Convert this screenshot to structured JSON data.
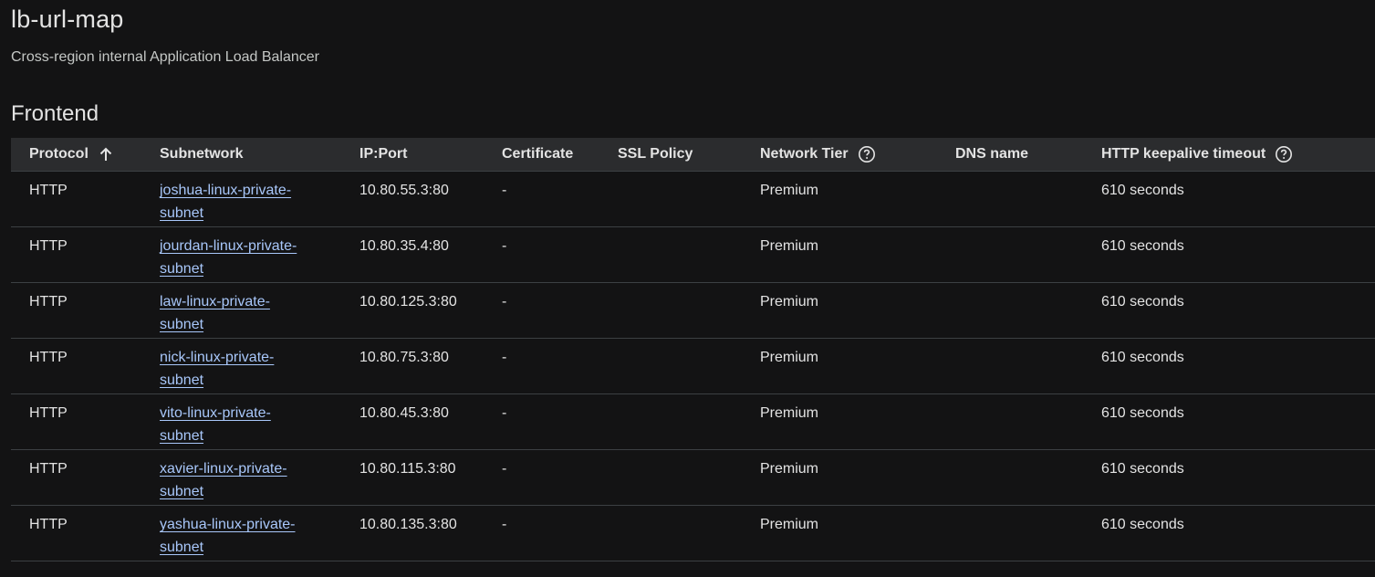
{
  "header": {
    "title": "lb-url-map",
    "subtitle": "Cross-region internal Application Load Balancer"
  },
  "frontend": {
    "section_title": "Frontend",
    "columns": {
      "protocol": "Protocol",
      "subnetwork": "Subnetwork",
      "ip_port": "IP:Port",
      "certificate": "Certificate",
      "ssl_policy": "SSL Policy",
      "network_tier": "Network Tier",
      "dns_name": "DNS name",
      "keepalive": "HTTP keepalive timeout"
    },
    "rows": [
      {
        "protocol": "HTTP",
        "subnet_line1": "joshua-linux-private-",
        "subnet_line2": "subnet",
        "ip_port": "10.80.55.3:80",
        "certificate": "-",
        "ssl_policy": "",
        "network_tier": "Premium",
        "dns_name": "",
        "keepalive": "610 seconds"
      },
      {
        "protocol": "HTTP",
        "subnet_line1": "jourdan-linux-private-",
        "subnet_line2": "subnet",
        "ip_port": "10.80.35.4:80",
        "certificate": "-",
        "ssl_policy": "",
        "network_tier": "Premium",
        "dns_name": "",
        "keepalive": "610 seconds"
      },
      {
        "protocol": "HTTP",
        "subnet_line1": "law-linux-private-",
        "subnet_line2": "subnet",
        "ip_port": "10.80.125.3:80",
        "certificate": "-",
        "ssl_policy": "",
        "network_tier": "Premium",
        "dns_name": "",
        "keepalive": "610 seconds"
      },
      {
        "protocol": "HTTP",
        "subnet_line1": "nick-linux-private-",
        "subnet_line2": "subnet",
        "ip_port": "10.80.75.3:80",
        "certificate": "-",
        "ssl_policy": "",
        "network_tier": "Premium",
        "dns_name": "",
        "keepalive": "610 seconds"
      },
      {
        "protocol": "HTTP",
        "subnet_line1": "vito-linux-private-",
        "subnet_line2": "subnet",
        "ip_port": "10.80.45.3:80",
        "certificate": "-",
        "ssl_policy": "",
        "network_tier": "Premium",
        "dns_name": "",
        "keepalive": "610 seconds"
      },
      {
        "protocol": "HTTP",
        "subnet_line1": "xavier-linux-private-",
        "subnet_line2": "subnet",
        "ip_port": "10.80.115.3:80",
        "certificate": "-",
        "ssl_policy": "",
        "network_tier": "Premium",
        "dns_name": "",
        "keepalive": "610 seconds"
      },
      {
        "protocol": "HTTP",
        "subnet_line1": "yashua-linux-private-",
        "subnet_line2": "subnet",
        "ip_port": "10.80.135.3:80",
        "certificate": "-",
        "ssl_policy": "",
        "network_tier": "Premium",
        "dns_name": "",
        "keepalive": "610 seconds"
      }
    ]
  },
  "icons": {
    "sort": "arrow-up-icon",
    "help": "help-circle-icon"
  },
  "colors": {
    "background": "#131314",
    "header_row": "#2b2c2e",
    "link": "#a8c7fa",
    "divider": "#3c4043"
  }
}
